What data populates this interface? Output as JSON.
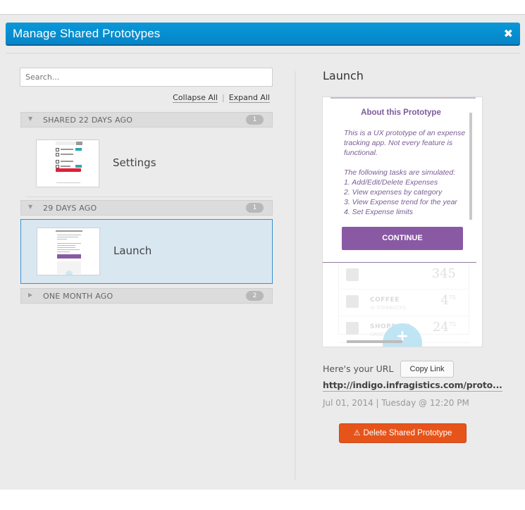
{
  "dialog": {
    "title": "Manage Shared Prototypes",
    "close_label": "✖"
  },
  "left": {
    "search": {
      "placeholder": "Search...",
      "value": ""
    },
    "collapse_all": "Collapse All",
    "separator": "|",
    "expand_all": "Expand All",
    "groups": [
      {
        "label": "SHARED 22 DAYS AGO",
        "count": "1",
        "expanded": true,
        "arrow": "▼",
        "items": [
          {
            "name": "Settings",
            "selected": false
          }
        ]
      },
      {
        "label": "29 DAYS AGO",
        "count": "1",
        "expanded": true,
        "arrow": "▼",
        "items": [
          {
            "name": "Launch",
            "selected": true
          }
        ]
      },
      {
        "label": "ONE MONTH AGO",
        "count": "2",
        "expanded": false,
        "arrow": "▶",
        "items": []
      }
    ]
  },
  "detail": {
    "title": "Launch",
    "preview": {
      "about_title": "About this Prototype",
      "paragraph1": "This is a UX prototype of an expense tracking app. Not every feature is functional.",
      "tasks_intro": "The following tasks are simulated:",
      "tasks": [
        "1. Add/Edit/Delete Expenses",
        "2. View expenses by category",
        "3. View Expense trend for the year",
        "4. Set Expense limits"
      ],
      "continue_label": "CONTINUE",
      "background_rows": [
        {
          "category": "",
          "subtitle": "",
          "amount": "345",
          "cents": ""
        },
        {
          "category": "COFFEE",
          "subtitle": "at STARBUCKS",
          "amount": "4",
          "cents": "75"
        },
        {
          "category": "SHOPPING",
          "subtitle": "GROCERIES",
          "amount": "24",
          "cents": "75"
        }
      ],
      "fab_label": "+"
    },
    "url_label": "Here's your URL",
    "copy_link_label": "Copy Link",
    "url": "http://indigo.infragistics.com/proto...",
    "date": "Jul 01, 2014 | Tuesday @ 12:20 PM",
    "delete_label": "Delete Shared Prototype",
    "delete_icon": "⚠"
  },
  "colors": {
    "title_bar": "#0a90d2",
    "accent_purple": "#8959a4",
    "delete_orange": "#e7541a",
    "selected_bg": "#d9e7f1",
    "selected_border": "#3a8fd0"
  }
}
